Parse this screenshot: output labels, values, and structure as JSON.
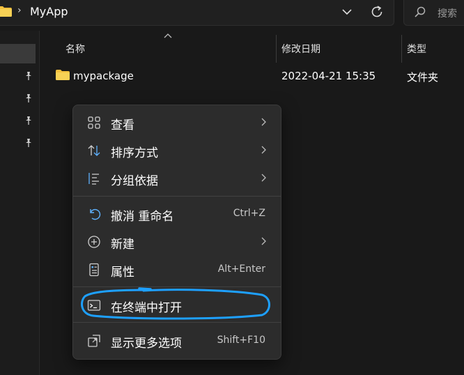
{
  "address_bar": {
    "breadcrumb": "MyApp"
  },
  "search": {
    "placeholder": "搜索"
  },
  "columns": {
    "name": "名称",
    "modified": "修改日期",
    "type": "类型"
  },
  "rows": [
    {
      "name": "mypackage",
      "modified": "2022-04-21 15:35",
      "type": "文件夹"
    }
  ],
  "context_menu": {
    "items": [
      {
        "label": "查看",
        "icon": "grid-icon",
        "submenu": true
      },
      {
        "label": "排序方式",
        "icon": "sort-icon",
        "submenu": true
      },
      {
        "label": "分组依据",
        "icon": "group-icon",
        "submenu": true
      },
      {
        "label": "撤消 重命名",
        "icon": "undo-icon",
        "shortcut": "Ctrl+Z"
      },
      {
        "label": "新建",
        "icon": "new-icon",
        "submenu": true
      },
      {
        "label": "属性",
        "icon": "properties-icon",
        "shortcut": "Alt+Enter"
      },
      {
        "label": "在终端中打开",
        "icon": "terminal-icon"
      },
      {
        "label": "显示更多选项",
        "icon": "more-options-icon",
        "shortcut": "Shift+F10"
      }
    ]
  },
  "colors": {
    "background": "#191919",
    "menu_background": "#2c2c2c",
    "folder_yellow": "#f4c03e",
    "highlight_annotation": "#1ea0ff"
  }
}
